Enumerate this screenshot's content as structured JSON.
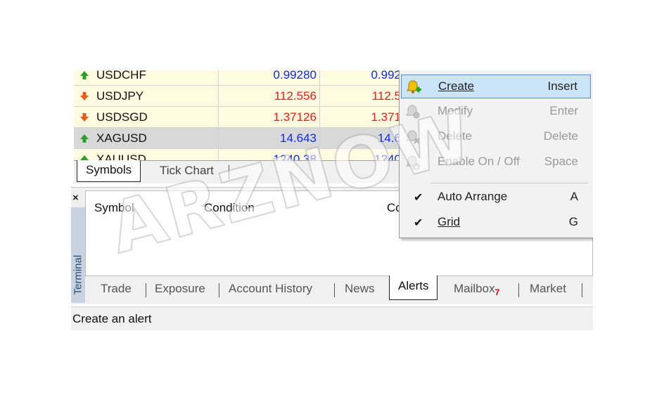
{
  "market_watch": {
    "rows": [
      {
        "symbol": "USDCHF",
        "bid": "0.99280",
        "ask": "0.992",
        "trend": "up",
        "bg": "yellow"
      },
      {
        "symbol": "USDJPY",
        "bid": "112.556",
        "ask": "112.5",
        "trend": "down",
        "bg": "yellow"
      },
      {
        "symbol": "USDSGD",
        "bid": "1.37126",
        "ask": "1.371",
        "trend": "down",
        "bg": "yellow"
      },
      {
        "symbol": "XAGUSD",
        "bid": "14.643",
        "ask": "14.6",
        "trend": "up",
        "bg": "gray"
      },
      {
        "symbol": "XAUUSD",
        "bid": "1240.38",
        "ask": "1240",
        "trend": "up",
        "bg": "yellow"
      }
    ],
    "tabs": [
      "Symbols",
      "Tick Chart"
    ]
  },
  "terminal": {
    "close": "×",
    "label": "Terminal",
    "columns": [
      "Symbol",
      "Condition",
      "Co"
    ],
    "tabs": [
      "Trade",
      "Exposure",
      "Account History",
      "News",
      "Alerts",
      "Mailbox",
      "Market"
    ],
    "mailbox_badge": "7",
    "active_tab": "Alerts"
  },
  "status_bar": {
    "text": "Create an alert"
  },
  "context_menu": {
    "items": [
      {
        "label": "Create",
        "key": "Insert",
        "enabled": true,
        "highlight": true
      },
      {
        "label": "Modify",
        "key": "Enter",
        "enabled": false
      },
      {
        "label": "Delete",
        "key": "Delete",
        "enabled": false
      },
      {
        "label": "Enable On / Off",
        "key": "Space",
        "enabled": false
      },
      {
        "label": "Auto Arrange",
        "key": "A",
        "checked": true
      },
      {
        "label": "Grid",
        "key": "G",
        "checked": true
      }
    ]
  },
  "watermark": "ARZNOW",
  "colors": {
    "up": "#0a27ff",
    "down": "#ff1515",
    "highlight": "#cce4f7"
  }
}
